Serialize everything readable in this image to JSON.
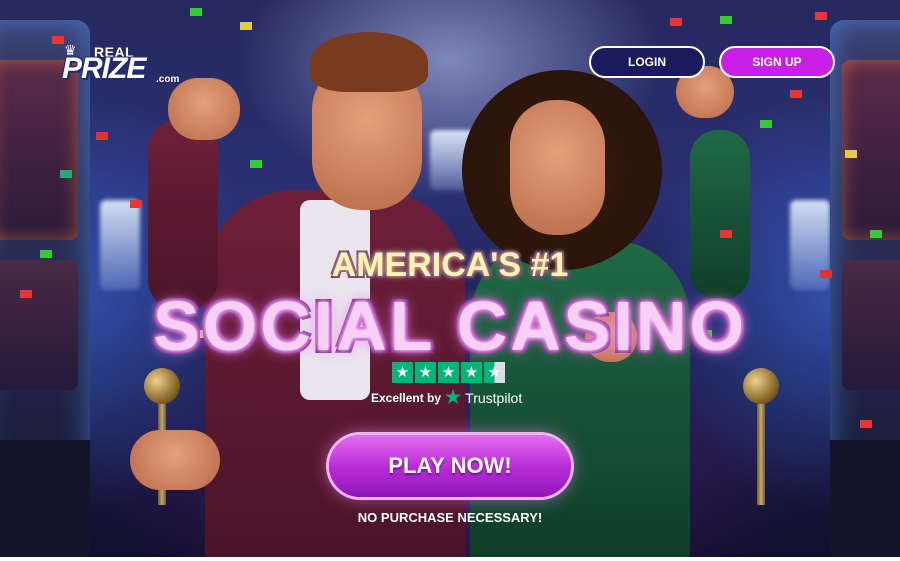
{
  "header": {
    "logo": {
      "small_text": "REAL",
      "big_text": "PRIZE",
      "suffix": ".com"
    },
    "login_label": "LOGIN",
    "signup_label": "SIGN UP"
  },
  "hero": {
    "tagline": "AMERICA'S #1",
    "headline": "SOCIAL CASINO",
    "rating": {
      "stars": 4.5,
      "text": "Excellent by",
      "brand": "Trustpilot"
    },
    "cta_label": "PLAY NOW!",
    "disclaimer": "NO PURCHASE NECESSARY!"
  },
  "colors": {
    "login_bg": "#1c1a5e",
    "signup_bg": "#c81ee6",
    "cta": "#b62ad6",
    "trustpilot_green": "#00b67a",
    "headline_glow": "#f36bf0"
  },
  "icons": [
    "crown-icon",
    "trustpilot-star-icon",
    "rating-star-icon"
  ]
}
